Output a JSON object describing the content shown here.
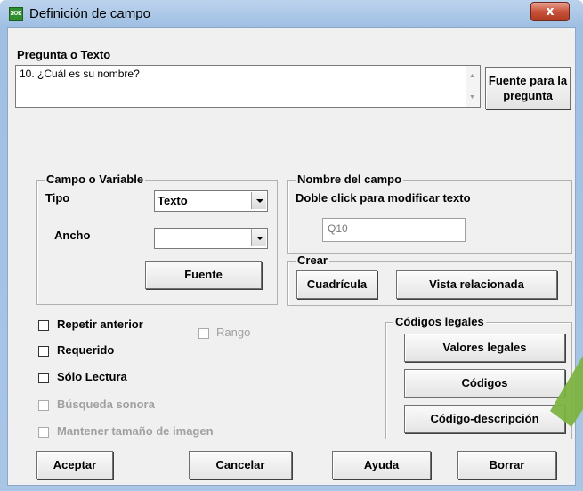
{
  "window": {
    "title": "Definición de campo",
    "close_glyph": "x",
    "icon_text": "ЖЖ"
  },
  "question": {
    "label": "Pregunta o Texto",
    "text": "10. ¿Cuál es su nombre?",
    "font_button": "Fuente para la pregunta"
  },
  "campo_variable": {
    "title": "Campo o Variable",
    "tipo_label": "Tipo",
    "tipo_value": "Texto",
    "ancho_label": "Ancho",
    "ancho_value": "",
    "fuente_button": "Fuente"
  },
  "nombre_campo": {
    "title": "Nombre del campo",
    "hint": "Doble click para modificar texto",
    "value": "Q10"
  },
  "crear": {
    "title": "Crear",
    "cuadricula_button": "Cuadrícula",
    "vista_button": "Vista relacionada"
  },
  "options": [
    {
      "label": "Repetir anterior",
      "enabled": true,
      "checked": false
    },
    {
      "label": "Requerido",
      "enabled": true,
      "checked": false
    },
    {
      "label": "Sólo Lectura",
      "enabled": true,
      "checked": false
    },
    {
      "label": "Búsqueda sonora",
      "enabled": false,
      "checked": false
    },
    {
      "label": "Mantener tamaño de imagen",
      "enabled": false,
      "checked": false
    }
  ],
  "rango": {
    "label": "Rango",
    "enabled": false,
    "checked": false
  },
  "codigos_legales": {
    "title": "Códigos legales",
    "valores_button": "Valores legales",
    "codigos_button": "Códigos",
    "codigo_desc_button": "Código-descripción"
  },
  "footer": {
    "aceptar": "Aceptar",
    "cancelar": "Cancelar",
    "ayuda": "Ayuda",
    "borrar": "Borrar"
  },
  "colors": {
    "annotation_arrow": "#7cb342"
  }
}
